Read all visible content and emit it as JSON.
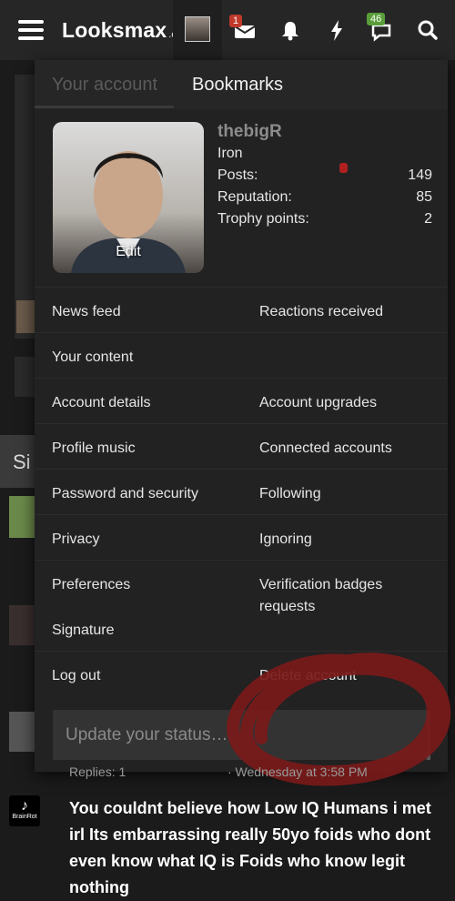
{
  "header": {
    "logo_text": "Looksmax",
    "logo_suffix": ".org",
    "conversations_badge": "1",
    "alerts_badge": "46"
  },
  "background": {
    "section_heading_fragment": "Si"
  },
  "account_menu": {
    "tabs": [
      {
        "label": "Your account",
        "active": true
      },
      {
        "label": "Bookmarks",
        "active": false
      }
    ],
    "profile": {
      "edit_label": "Edit",
      "username": "thebigR",
      "rank": "Iron",
      "stats": [
        {
          "label": "Posts:",
          "value": "149"
        },
        {
          "label": "Reputation:",
          "value": "85"
        },
        {
          "label": "Trophy points:",
          "value": "2"
        }
      ]
    },
    "links": {
      "news_feed": "News feed",
      "reactions_received": "Reactions received",
      "your_content": "Your content",
      "account_details": "Account details",
      "account_upgrades": "Account upgrades",
      "profile_music": "Profile music",
      "connected_accounts": "Connected accounts",
      "password_security": "Password and security",
      "following": "Following",
      "privacy": "Privacy",
      "ignoring": "Ignoring",
      "preferences": "Preferences",
      "verification_badges": "Verification badges requests",
      "signature": "Signature",
      "log_out": "Log out",
      "delete_account": "Delete account"
    },
    "status_placeholder": "Update your status…"
  },
  "thread_below": {
    "replies": "Replies: 1",
    "date": "· Wednesday at 3:58 PM",
    "thumb_label": "BrainRot",
    "title": "You couldnt believe how Low IQ Humans i met irl Its embarrassing really 50yo foids who dont even know what IQ is Foids who know legit nothing"
  },
  "colors": {
    "scribble": "#7a1a1a",
    "badge_red": "#c0392b",
    "badge_green": "#5a9e3a"
  }
}
